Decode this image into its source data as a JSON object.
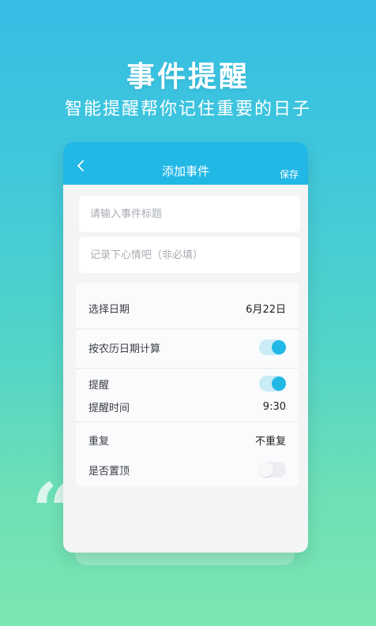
{
  "hero": {
    "title": "事件提醒",
    "subtitle": "智能提醒帮你记住重要的日子"
  },
  "app": {
    "header": {
      "title": "添加事件",
      "save_label": "保存",
      "back_icon": "chevron-left-icon"
    },
    "event_title_input": {
      "placeholder": "请输入事件标题",
      "value": ""
    },
    "mood_input": {
      "placeholder": "记录下心情吧（非必填）",
      "value": ""
    },
    "settings": {
      "date": {
        "label": "选择日期",
        "value": "6月22日"
      },
      "lunar": {
        "label": "按农历日期计算",
        "enabled": true
      },
      "reminder": {
        "label": "提醒",
        "enabled": true
      },
      "reminder_time": {
        "label": "提醒时间",
        "value": "9:30"
      },
      "repeat": {
        "label": "重复",
        "value": "不重复"
      },
      "pin_top": {
        "label": "是否置顶",
        "enabled": false
      }
    }
  },
  "colors": {
    "accent": "#22b8e6",
    "background_top": "#35bde6",
    "background_bottom": "#7ce6b0"
  }
}
